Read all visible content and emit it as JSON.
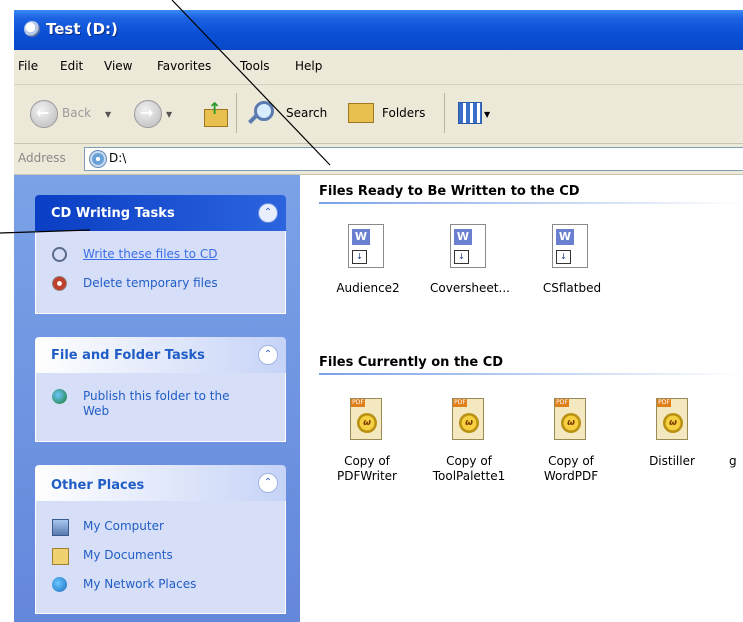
{
  "window": {
    "title": "Test (D:)"
  },
  "menu": [
    "File",
    "Edit",
    "View",
    "Favorites",
    "Tools",
    "Help"
  ],
  "toolbar": {
    "back_label": "Back",
    "search_label": "Search",
    "folders_label": "Folders"
  },
  "address": {
    "label": "Address",
    "value": "D:\\"
  },
  "taskpane": {
    "cd_tasks": {
      "title": "CD Writing Tasks",
      "items": [
        "Write these files to CD",
        "Delete temporary files"
      ]
    },
    "folder_tasks": {
      "title": "File and Folder Tasks",
      "items": [
        "Publish this folder to the Web"
      ]
    },
    "other_places": {
      "title": "Other Places",
      "items": [
        "My Computer",
        "My Documents",
        "My Network Places"
      ]
    }
  },
  "content": {
    "ready_group": {
      "title": "Files Ready to Be Written to the CD",
      "files": [
        "Audience2",
        "Coversheet...",
        "CSflatbed"
      ]
    },
    "current_group": {
      "title": "Files Currently on the CD",
      "files": [
        [
          "Copy of",
          "PDFWriter"
        ],
        [
          "Copy of",
          "ToolPalette1"
        ],
        [
          "Copy of",
          "WordPDF"
        ],
        [
          "Distiller",
          ""
        ],
        [
          "g",
          ""
        ]
      ]
    }
  },
  "colors": {
    "title_bar": "#0a4fd6",
    "task_pane": "#6f95e1",
    "link": "#215dc6"
  },
  "icons": {
    "doc_glyph": "W",
    "pdf_glyph": "ω"
  }
}
